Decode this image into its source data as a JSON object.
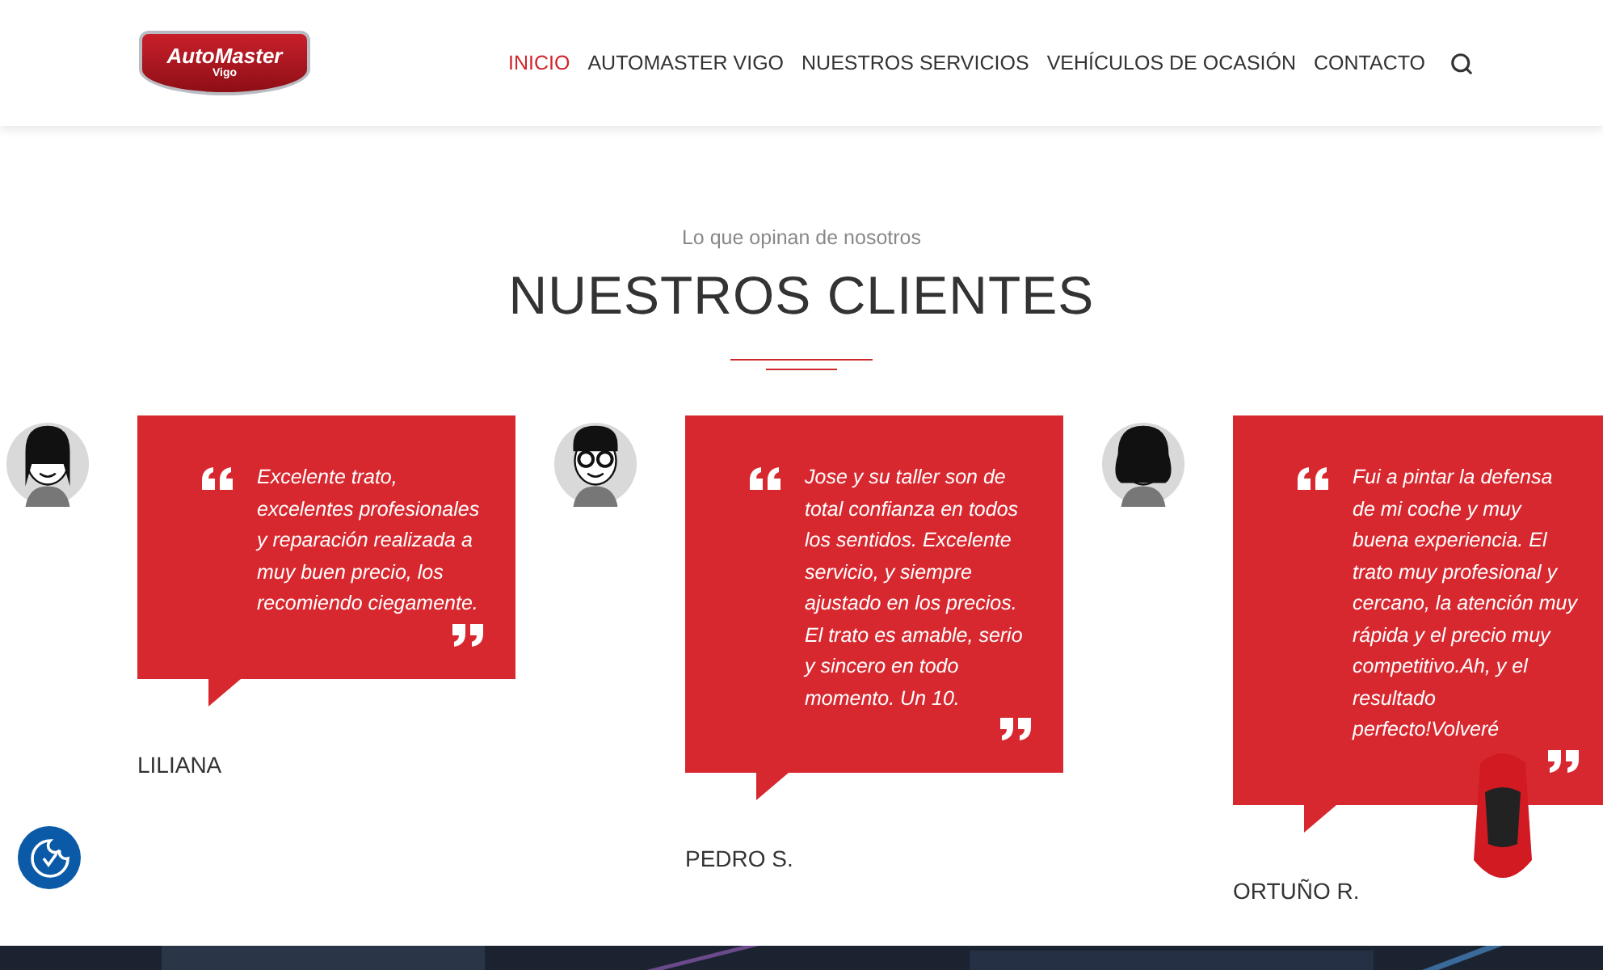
{
  "logo": {
    "brand": "AutoMaster",
    "city": "Vigo"
  },
  "nav": [
    {
      "label": "INICIO",
      "selected": true
    },
    {
      "label": "AUTOMASTER VIGO",
      "selected": false
    },
    {
      "label": "NUESTROS SERVICIOS",
      "selected": false
    },
    {
      "label": "VEHÍCULOS DE OCASIÓN",
      "selected": false
    },
    {
      "label": "CONTACTO",
      "selected": false
    }
  ],
  "section": {
    "subtitle": "Lo que opinan de nosotros",
    "title": "NUESTROS CLIENTES"
  },
  "testimonials": [
    {
      "kind": "girl",
      "quote": "Excelente trato, excelentes profesionales y reparación realizada a muy buen precio, los recomiendo ciegamente.",
      "name": "LILIANA"
    },
    {
      "kind": "boy",
      "quote": "Jose y su taller son de total confianza en todos los sentidos. Excelente servicio, y siempre ajustado en los precios. El trato es amable, serio y sincero en todo momento. Un 10.",
      "name": "PEDRO S."
    },
    {
      "kind": "woman",
      "quote": "Fui a pintar la defensa de mi coche y muy buena experiencia. El trato muy profesional y cercano, la atención muy rápida y el precio muy competitivo.Ah, y el resultado perfecto!Volveré",
      "name": "ORTUÑO R."
    }
  ]
}
